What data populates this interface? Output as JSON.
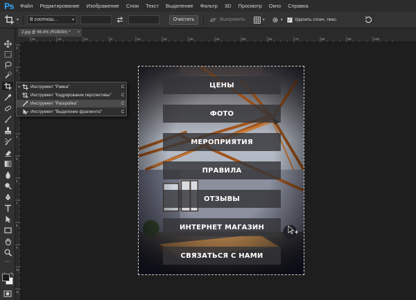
{
  "app": {
    "logo": "Ps"
  },
  "menu": [
    "Файл",
    "Редактирование",
    "Изображение",
    "Слои",
    "Текст",
    "Выделение",
    "Фильтр",
    "3D",
    "Просмотр",
    "Окно",
    "Справка"
  ],
  "options": {
    "ratio_value": "В соотнош...",
    "clear_label": "Очистить",
    "straighten_label": "Выпрямить",
    "delete_cropped_label": "Удалить отсеч. пикс.",
    "delete_cropped_checked": true
  },
  "document": {
    "tab_title": "2.jpg @ 66,4% (RGB/8#) *",
    "close_symbol": "×"
  },
  "ruler_h_labels": [
    "30",
    "20",
    "10",
    "0",
    "10",
    "20",
    "30",
    "40",
    "50",
    "60",
    "70",
    "80",
    "90",
    "100"
  ],
  "ruler_v_labels": [
    "0",
    "1",
    "2",
    "3",
    "4",
    "5",
    "6",
    "7",
    "8",
    "9",
    "10",
    "11"
  ],
  "flyout": [
    {
      "label": "Инструмент \"Рамка\"",
      "key": "C",
      "icon": "crop-icon",
      "current": true,
      "selected": false
    },
    {
      "label": "Инструмент \"Кадрирование перспективы\"",
      "key": "C",
      "icon": "perspective-crop-icon",
      "current": false,
      "selected": false
    },
    {
      "label": "Инструмент \"Раскройка\"",
      "key": "C",
      "icon": "slice-icon",
      "current": false,
      "selected": true
    },
    {
      "label": "Инструмент \"Выделение фрагмента\"",
      "key": "C",
      "icon": "slice-select-icon",
      "current": false,
      "selected": false
    }
  ],
  "canvas_buttons": [
    "ЦЕНЫ",
    "ФОТО",
    "МЕРОПРИЯТИЯ",
    "ПРАВИЛА",
    "ОТЗЫВЫ",
    "ИНТЕРНЕТ МАГАЗИН",
    "СВЯЗАТЬСЯ С НАМИ"
  ],
  "colors": {
    "foreground": "#1b1b1b",
    "background": "#f0f0f0",
    "accent": "#31a8ff"
  }
}
